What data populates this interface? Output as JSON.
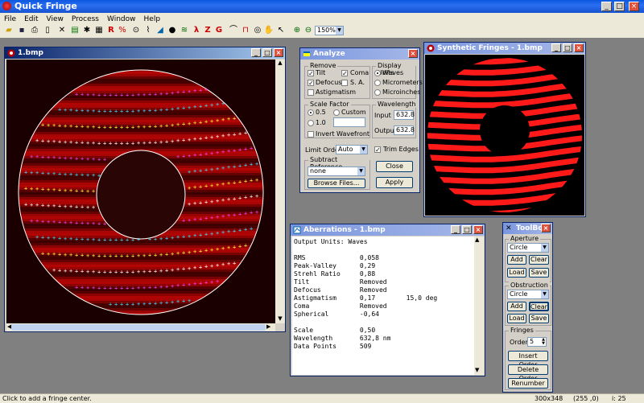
{
  "app": {
    "title": "Quick Fringe"
  },
  "menu": [
    "File",
    "Edit",
    "View",
    "Process",
    "Window",
    "Help"
  ],
  "toolbar": {
    "zoom": "150%"
  },
  "image_window": {
    "title": "1.bmp"
  },
  "analyze": {
    "title": "Analyze",
    "remove_label": "Remove",
    "tilt": "Tilt",
    "coma": "Coma",
    "defocus": "Defocus",
    "sa": "S. A.",
    "astig": "Astigmatism",
    "display_units_label": "Display Units",
    "waves": "Waves",
    "micrometers": "Micrometers",
    "microinches": "Microinches",
    "scale_factor_label": "Scale Factor",
    "s05": "0.5",
    "custom": "Custom",
    "s10": "1.0",
    "invert": "Invert Wavefront",
    "wavelength_label": "Wavelength",
    "input_label": "Input",
    "input_value": "632.8",
    "output_label": "Output",
    "output_value": "632.8",
    "limit_order_label": "Limit Order",
    "limit_order_value": "Auto",
    "trim_edges": "Trim Edges",
    "subtract_ref_label": "Subtract Reference",
    "subtract_ref_value": "none",
    "browse": "Browse Files...",
    "close": "Close",
    "apply": "Apply"
  },
  "synthetic": {
    "title": "Synthetic Fringes - 1.bmp"
  },
  "aberrations": {
    "title": "Aberrations - 1.bmp",
    "lines": [
      "Output Units: Waves",
      "",
      "RMS              0,058",
      "Peak-Valley      0,29",
      "Strehl Ratio     0,88",
      "Tilt             Removed",
      "Defocus          Removed",
      "Astigmatism      0,17        15,0 deg",
      "Coma             Removed",
      "Spherical        -0,64",
      "",
      "Scale            0,50",
      "Wavelength       632,8 nm",
      "Data Points      509"
    ]
  },
  "toolbox": {
    "title": "ToolBox",
    "aperture_label": "Aperture",
    "aperture_value": "Circle",
    "add": "Add",
    "clear": "Clear",
    "load": "Load",
    "save": "Save",
    "obstruction_label": "Obstruction",
    "obstruction_value": "Circle",
    "fringes_label": "Fringes",
    "order_label": "Order",
    "order_value": "5",
    "insert_order": "Insert Order",
    "delete_order": "Delete Order",
    "renumber": "Renumber"
  },
  "status": {
    "message": "Click to add a fringe center.",
    "size": "300x348",
    "rgb": "(255 ,0)",
    "i": "i: 25"
  }
}
